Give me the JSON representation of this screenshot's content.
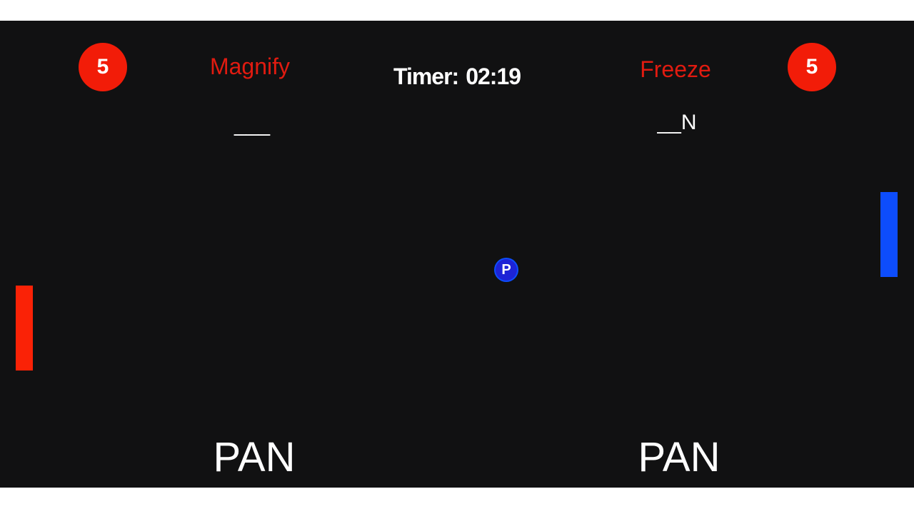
{
  "colors": {
    "board": "#111112",
    "player_left": "#fa2206",
    "player_right": "#0d4dfc",
    "powerup_text": "#e11b10",
    "ball": "#1d23d6",
    "score_badge": "#f21c08",
    "text": "#ffffff"
  },
  "player_left": {
    "score": "5",
    "powerup": "Magnify",
    "word_progress": "___",
    "target_word": "PAN"
  },
  "player_right": {
    "score": "5",
    "powerup": "Freeze",
    "word_progress": "__N",
    "target_word": "PAN"
  },
  "timer": {
    "label": "Timer:",
    "value": "02:19"
  },
  "ball": {
    "letter": "P"
  }
}
